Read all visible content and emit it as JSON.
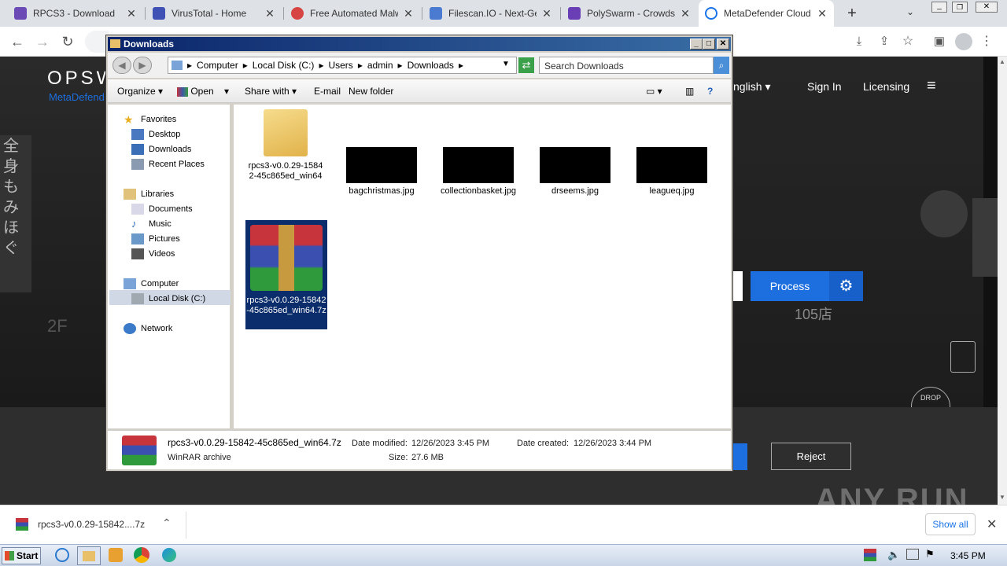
{
  "browser": {
    "tabs": [
      {
        "label": "RPCS3 - Download",
        "color": "#6c4ab6"
      },
      {
        "label": "VirusTotal - Home",
        "color": "#3f51b5"
      },
      {
        "label": "Free Automated Malwa",
        "color": "#d64541"
      },
      {
        "label": "Filescan.IO - Next-Gen",
        "color": "#4a7bd0"
      },
      {
        "label": "PolySwarm - Crowdsou",
        "color": "#6a3fb5"
      },
      {
        "label": "MetaDefender Cloud |",
        "color": "#1a73e8"
      }
    ],
    "new_tab": "+"
  },
  "site": {
    "logo": "OPSW",
    "logo_sub": "MetaDefend",
    "nav_language": "nglish",
    "nav_signin": "Sign In",
    "nav_licensing": "Licensing",
    "process_button": "Process",
    "reject_button": "Reject",
    "drop_text": "DROP",
    "bg_text_1": "105店",
    "bg_text_2": "2F"
  },
  "explorer": {
    "title": "Downloads",
    "breadcrumb": [
      "Computer",
      "Local Disk (C:)",
      "Users",
      "admin",
      "Downloads"
    ],
    "search_placeholder": "Search Downloads",
    "toolbar": {
      "organize": "Organize",
      "open": "Open",
      "share_with": "Share with",
      "email": "E-mail",
      "new_folder": "New folder"
    },
    "nav": {
      "favorites": "Favorites",
      "desktop": "Desktop",
      "downloads": "Downloads",
      "recent": "Recent Places",
      "libraries": "Libraries",
      "documents": "Documents",
      "music": "Music",
      "pictures": "Pictures",
      "videos": "Videos",
      "computer": "Computer",
      "local_disk": "Local Disk (C:)",
      "network": "Network"
    },
    "files": {
      "folder": "rpcs3-v0.0.29-15842-45c865ed_win64",
      "img1": "bagchristmas.jpg",
      "img2": "collectionbasket.jpg",
      "img3": "drseems.jpg",
      "img4": "leagueq.jpg",
      "archive": "rpcs3-v0.0.29-15842-45c865ed_win64.7z"
    },
    "details": {
      "name": "rpcs3-v0.0.29-15842-45c865ed_win64.7z",
      "type": "WinRAR archive",
      "modified_label": "Date modified:",
      "modified": "12/26/2023 3:45 PM",
      "created_label": "Date created:",
      "created": "12/26/2023 3:44 PM",
      "size_label": "Size:",
      "size": "27.6 MB"
    }
  },
  "download_bar": {
    "file": "rpcs3-v0.0.29-15842....7z",
    "show_all": "Show all"
  },
  "taskbar": {
    "start": "Start",
    "clock": "3:45 PM"
  },
  "watermark": "ANY RUN"
}
